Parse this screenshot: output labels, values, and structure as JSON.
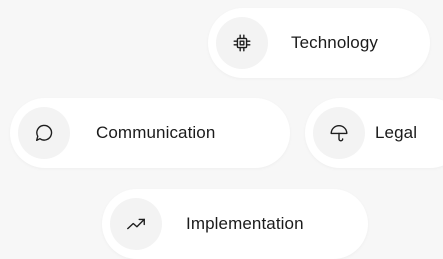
{
  "tags": [
    {
      "label": "Technology",
      "icon": "chip-icon"
    },
    {
      "label": "Communication",
      "icon": "chat-bubble-icon"
    },
    {
      "label": "Legal",
      "icon": "umbrella-icon"
    },
    {
      "label": "Implementation",
      "icon": "trend-up-icon"
    }
  ],
  "colors": {
    "background": "#f7f7f7",
    "pill": "#ffffff",
    "icon_circle": "#f3f3f3",
    "text": "#1b1b1b"
  }
}
